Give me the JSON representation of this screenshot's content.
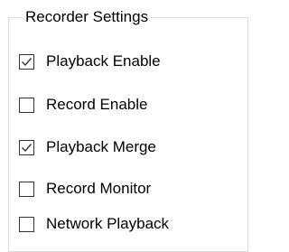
{
  "group": {
    "title": "Recorder Settings"
  },
  "options": [
    {
      "label": "Playback Enable",
      "checked": true
    },
    {
      "label": "Record Enable",
      "checked": false
    },
    {
      "label": "Playback Merge",
      "checked": true
    },
    {
      "label": "Record Monitor",
      "checked": false
    },
    {
      "label": "Network Playback",
      "checked": false
    }
  ],
  "icons": {
    "checked": "check-mark-icon"
  },
  "colors": {
    "border": "#dcdcdc",
    "checkbox_border": "#333333",
    "text": "#000000",
    "background": "#ffffff"
  }
}
